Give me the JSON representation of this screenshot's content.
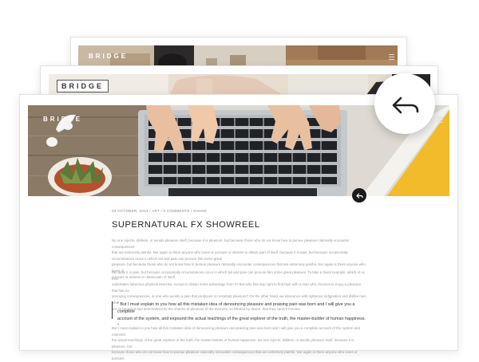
{
  "back_card": {
    "brand": "BRIDGE"
  },
  "middle_card": {
    "brand": "BRIDGE"
  },
  "front_card": {
    "brand": "BRIDGE",
    "post": {
      "meta": "04 OCTOBER, 2013 / ART / 0 COMMENTS / SHARE",
      "title": "SUPERNATURAL FX SHOWREEL",
      "paragraph1": [
        "No one rejects, dislikes, or avoids pleasure itself, because it is pleasure, but because those who do not know how to pursue pleasure rationally encounter consequences",
        "that are extremely painful. Nor again is there anyone who loves or pursues or desires to obtain pain of itself, because it is pain, but because occasionally circumstances occur in which toil and pain can procure him some great",
        "pleasure, but because those who do not know how to pursue pleasure rationally encounter consequences that are extremely painful. Nor again is there anyone who loves or",
        "pursues or desires to obtain pain of itself."
      ],
      "paragraph2": [
        "Because it is pain, but because occasionally circumstances occur in which toil and pain can procure him some great pleasure. To take a trivial example, which of us ever",
        "undertakes laborious physical exercise, except to obtain some advantage from it? But who has any right to find fault with a man who chooses to enjoy a pleasure that has no",
        "annoying consequences, or one who avoids a pain that produces no resultant pleasure? On the other hand, we denounce with righteous indignation and dislike men who",
        "are so beguiled and demoralized by the charms of pleasure of the moment, so blinded by desire, that they cannot foresee."
      ],
      "quote": [
        "\" But I must explain to you how all this mistaken idea of denouncing pleasure and praising pain was born and I will give you a complete",
        "account of the system, and expound the actual teachings of the great explorer of the truth, the master-builder of human happiness. \""
      ],
      "paragraph3": [
        "But I must explain to you how all this mistaken idea of denouncing pleasure and praising pain was born and I will give you a complete account of the system and expound",
        "the actual teachings of the great explorer of the truth, the master-builder of human happiness. No one rejects, dislikes, or avoids pleasure itself, because it is pleasure, but",
        "because those who do not know how to pursue pleasure rationally encounter consequences that are extremely painful. Nor again is there anyone who loves or pursues"
      ]
    }
  },
  "icons": {
    "back": "back-arrow-icon",
    "small": "back-arrow-icon",
    "menu": "hamburger-menu-icon"
  },
  "colors": {
    "yellow_accent": "#f2bb2b",
    "dark_circle": "#1a1a1a",
    "desk_wood": "#8a7a66"
  }
}
